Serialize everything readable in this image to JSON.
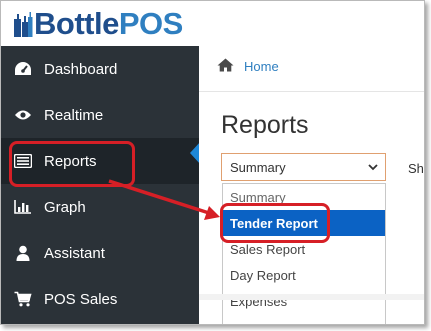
{
  "app": {
    "logo_part1": "Bottle",
    "logo_part2": "POS"
  },
  "colors": {
    "sidebar_bg": "#2b3238",
    "accent": "#1e88d8",
    "selected_option": "#0b62c4",
    "annotation": "#d61f26"
  },
  "sidebar": {
    "items": [
      {
        "label": "Dashboard",
        "icon": "dashboard-icon"
      },
      {
        "label": "Realtime",
        "icon": "eye-icon"
      },
      {
        "label": "Reports",
        "icon": "report-icon",
        "active": true
      },
      {
        "label": "Graph",
        "icon": "bar-chart-icon"
      },
      {
        "label": "Assistant",
        "icon": "user-icon"
      },
      {
        "label": "POS Sales",
        "icon": "cart-icon"
      }
    ]
  },
  "breadcrumb": {
    "home_label": "Home"
  },
  "main": {
    "title": "Reports",
    "report_select": {
      "value": "Summary"
    },
    "show_label_partial": "Sh",
    "dropdown_options": [
      {
        "label": "Summary"
      },
      {
        "label": "Tender Report",
        "selected": true
      },
      {
        "label": "Sales Report"
      },
      {
        "label": "Day Report"
      },
      {
        "label": "Expenses"
      }
    ]
  }
}
